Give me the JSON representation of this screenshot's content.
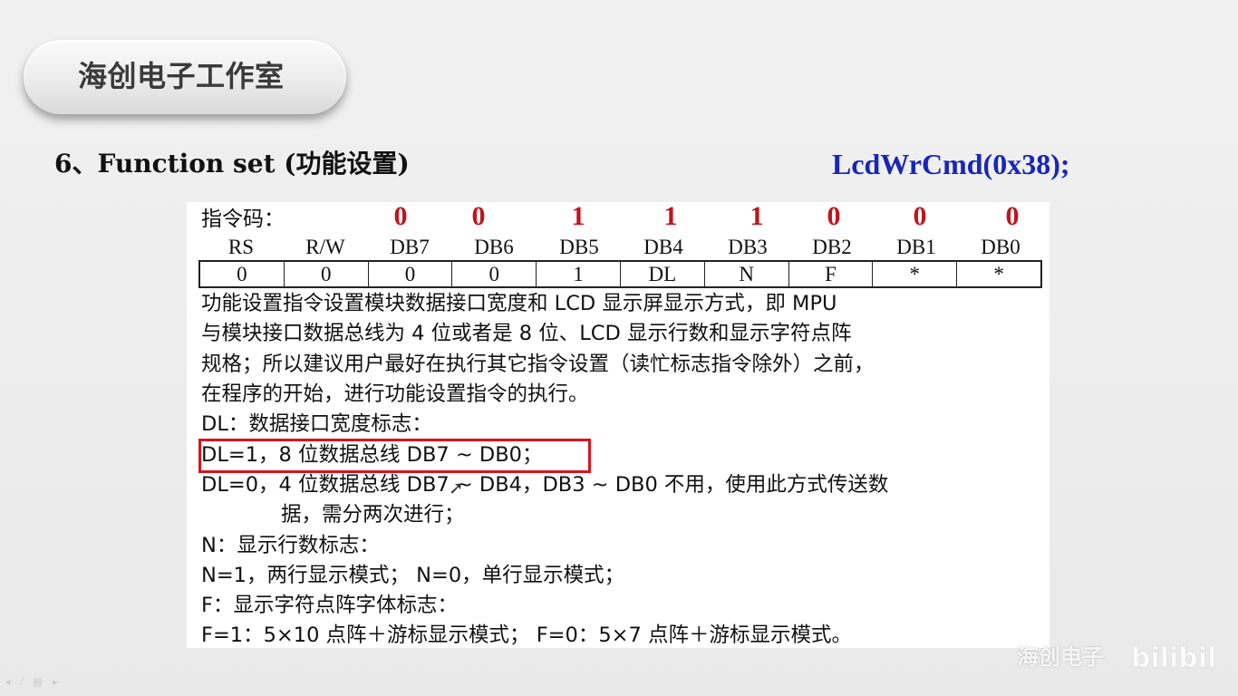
{
  "header": {
    "studio_name": "海创电子工作室"
  },
  "slide": {
    "title": "6、Function set (功能设置)",
    "code": "LcdWrCmd(0x38);"
  },
  "instruction": {
    "label": "指令码：",
    "bits": [
      "0",
      "0",
      "1",
      "1",
      "1",
      "0",
      "0",
      "0"
    ],
    "columns": [
      "RS",
      "R/W",
      "DB7",
      "DB6",
      "DB5",
      "DB4",
      "DB3",
      "DB2",
      "DB1",
      "DB0"
    ],
    "cells": [
      "0",
      "0",
      "0",
      "0",
      "1",
      "DL",
      "N",
      "F",
      "*",
      "*"
    ]
  },
  "description": {
    "lines": [
      "功能设置指令设置模块数据接口宽度和  LCD  显示屏显示方式，即  MPU",
      "与模块接口数据总线为 4 位或者是 8 位、LCD 显示行数和显示字符点阵",
      "规格；所以建议用户最好在执行其它指令设置（读忙标志指令除外）之前，",
      "在程序的开始，进行功能设置指令的执行。",
      "DL：数据接口宽度标志：",
      "DL=1，8 位数据总线 DB7 ~ DB0；",
      "DL=0，4 位数据总线 DB7 ~ DB4，DB3 ~ DB0 不用，使用此方式传送数",
      "据，需分两次进行；",
      "N：显示行数标志：",
      "N=1，两行显示模式；  N=0，单行显示模式；",
      "F：显示字符点阵字体标志：",
      "F=1：5×10 点阵＋游标显示模式；  F=0：5×7 点阵＋游标显示模式。"
    ]
  },
  "watermark": {
    "text": "海创电子",
    "logo_text": "bilibili"
  },
  "cursor": {
    "icon": "arrow-cursor-icon"
  }
}
